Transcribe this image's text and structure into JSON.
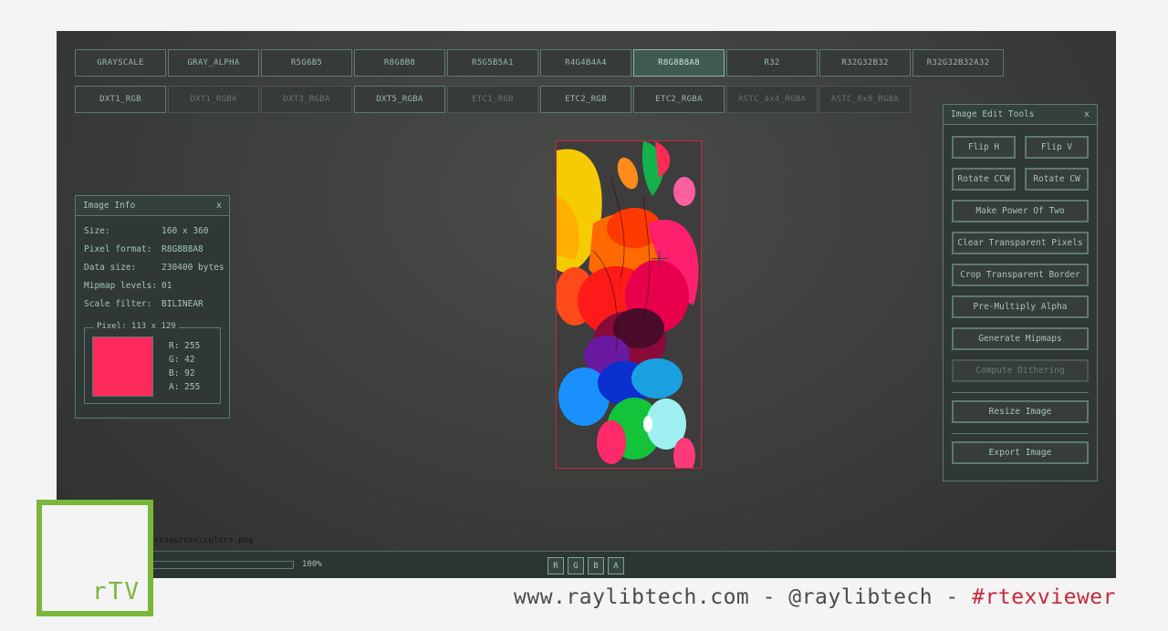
{
  "formats_row1": [
    {
      "label": "GRAYSCALE",
      "state": "normal"
    },
    {
      "label": "GRAY_ALPHA",
      "state": "normal"
    },
    {
      "label": "R5G6B5",
      "state": "normal"
    },
    {
      "label": "R8G8B8",
      "state": "normal"
    },
    {
      "label": "R5G5B5A1",
      "state": "normal"
    },
    {
      "label": "R4G4B4A4",
      "state": "normal"
    },
    {
      "label": "R8G8B8A8",
      "state": "active"
    },
    {
      "label": "R32",
      "state": "normal"
    },
    {
      "label": "R32G32B32",
      "state": "normal"
    },
    {
      "label": "R32G32B32A32",
      "state": "normal"
    }
  ],
  "formats_row2": [
    {
      "label": "DXT1_RGB",
      "state": "normal"
    },
    {
      "label": "DXT1_RGBA",
      "state": "dim"
    },
    {
      "label": "DXT3_RGBA",
      "state": "dim"
    },
    {
      "label": "DXT5_RGBA",
      "state": "normal"
    },
    {
      "label": "ETC1_RGB",
      "state": "dim"
    },
    {
      "label": "ETC2_RGB",
      "state": "normal"
    },
    {
      "label": "ETC2_RGBA",
      "state": "normal"
    },
    {
      "label": "ASTC_4x4_RGBA",
      "state": "dim"
    },
    {
      "label": "ASTC_8x8_RGBA",
      "state": "dim"
    }
  ],
  "image_info": {
    "title": "Image Info",
    "close": "x",
    "rows": [
      {
        "label": "Size:",
        "value": "160 x 360"
      },
      {
        "label": "Pixel format:",
        "value": "R8G8B8A8"
      },
      {
        "label": "Data size:",
        "value": "230400 bytes"
      },
      {
        "label": "Mipmap levels:",
        "value": "01"
      },
      {
        "label": "Scale filter:",
        "value": "BILINEAR"
      }
    ],
    "pixel_title": "Pixel: 113 x 129",
    "pixel_color": "#ff2a5c",
    "channels": [
      "R: 255",
      "G: 42",
      "B: 92",
      "A: 255"
    ]
  },
  "edit_tools": {
    "title": "Image Edit Tools",
    "close": "x",
    "flip_h": "Flip H",
    "flip_v": "Flip V",
    "rotate_ccw": "Rotate CCW",
    "rotate_cw": "Rotate CW",
    "make_pot": "Make Power Of Two",
    "clear_transparent": "Clear Transparent Pixels",
    "crop_transparent": "Crop Transparent Border",
    "premultiply": "Pre-Multiply Alpha",
    "gen_mipmaps": "Generate Mipmaps",
    "dithering": "Compute Dithering",
    "resize": "Resize Image",
    "export": "Export Image"
  },
  "status": {
    "path": "...\\rtexviewer\\src\\resources\\colors.png",
    "zoom": "100%",
    "zoom_fraction": 0.05,
    "channels": [
      "R",
      "G",
      "B",
      "A"
    ]
  },
  "logo": {
    "text": "rTV"
  },
  "footer": {
    "site": "www.raylibtech.com - @raylibtech - ",
    "tag": "#rtexviewer"
  },
  "colors": {
    "accent_border": "#5c7a70",
    "active_format": "#3f5a4f",
    "selection_border": "#c8283c",
    "logo_green": "#7bb63a"
  }
}
